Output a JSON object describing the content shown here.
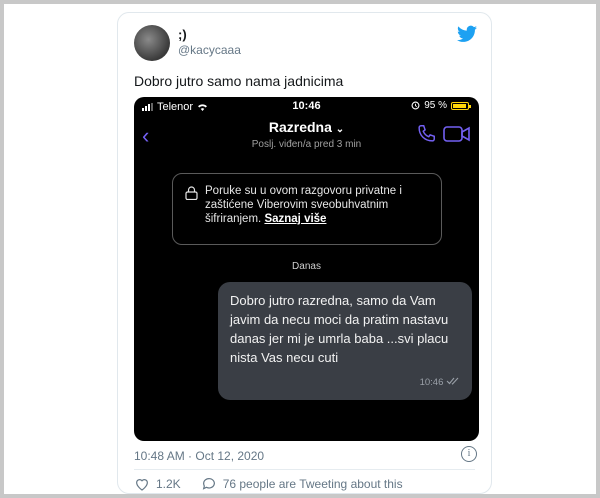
{
  "tweet": {
    "author_name": ";)",
    "author_handle": "@kacycaaa",
    "text": "Dobro jutro samo nama jadnicima",
    "timestamp": "10:48 AM · Oct 12, 2020",
    "likes": "1.2K",
    "discussion": "76 people are Tweeting about this",
    "brand_color": "#1da1f2"
  },
  "phone": {
    "carrier": "Telenor",
    "time": "10:46",
    "battery": "95 %",
    "battery_level": 0.95,
    "chat_title": "Razredna",
    "chat_subtitle": "Poslj. viđen/a pred 3 min",
    "privacy_text": "Poruke su u ovom razgovoru privatne i zaštićene Viberovim sveobuhvatnim šifriranjem.",
    "privacy_link": "Saznaj više",
    "day_label": "Danas",
    "message_text": "Dobro jutro razredna, samo da Vam javim da necu moci da pratim nastavu danas jer mi je umrla baba ...svi placu nista Vas necu cuti",
    "message_time": "10:46",
    "accent_color": "#7360f2"
  },
  "icons": {
    "brand": "twitter-bird-icon",
    "back": "chevron-left-icon",
    "call": "phone-icon",
    "video": "video-camera-icon",
    "lock": "lock-icon",
    "info": "info-icon",
    "like": "heart-icon",
    "reply": "speech-bubble-icon"
  }
}
